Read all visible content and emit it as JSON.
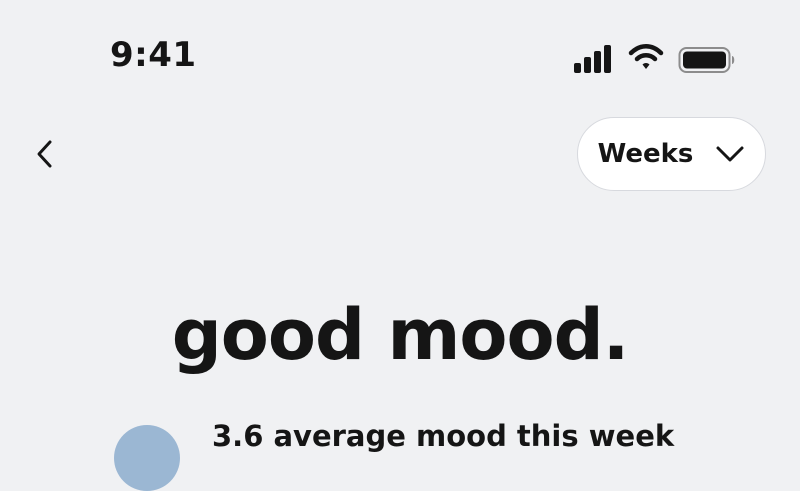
{
  "status_bar": {
    "time": "9:41",
    "icons": [
      "signal-icon",
      "wifi-icon",
      "battery-icon"
    ]
  },
  "nav": {
    "back_icon": "chevron-left-icon",
    "period_dropdown": {
      "selected": "Weeks",
      "icon": "chevron-down-icon"
    }
  },
  "main": {
    "headline": "good mood.",
    "summary": "3.6 average mood this week"
  },
  "colors": {
    "background": "#f0f1f3",
    "text": "#151515",
    "dropdown_background": "#ffffff",
    "mood_avatar": "#9bb7d3"
  }
}
